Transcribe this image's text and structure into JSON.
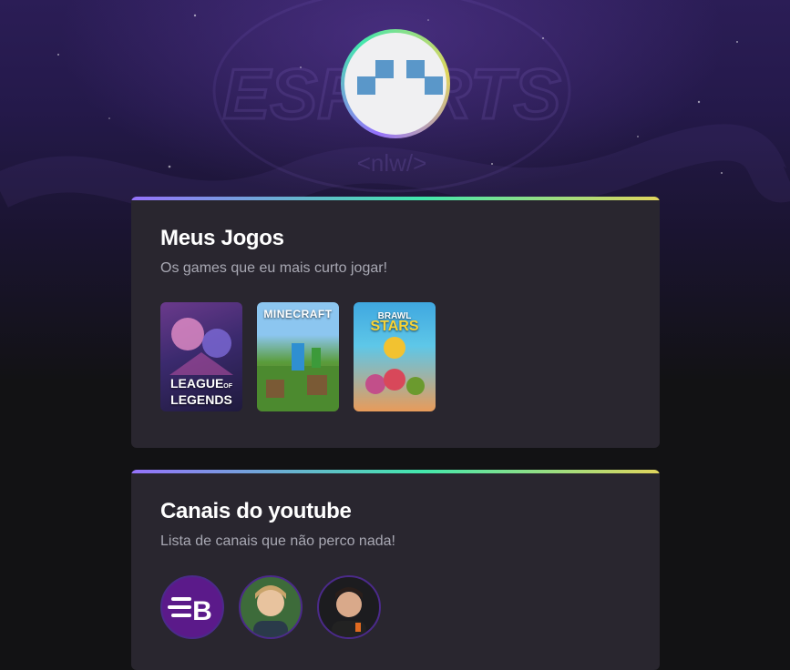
{
  "background": {
    "logo_text": "ESPORTS",
    "logo_subtext": "<nlw/>"
  },
  "profile": {
    "avatar": "github-identicon-avatar"
  },
  "games_section": {
    "title": "Meus Jogos",
    "subtitle": "Os games que eu mais curto jogar!",
    "games": [
      {
        "name": "League of Legends",
        "line1": "LEAGUE",
        "line1b": "OF",
        "line2": "LEGENDS"
      },
      {
        "name": "Minecraft",
        "line1": "MINECRAFT"
      },
      {
        "name": "Brawl Stars",
        "line1": "BRAWL",
        "line2": "STARS"
      }
    ]
  },
  "youtube_section": {
    "title": "Canais do youtube",
    "subtitle": "Lista de canais que não perco nada!",
    "channels": [
      {
        "avatar": "rocketseat-logo",
        "letter": "B"
      },
      {
        "avatar": "channel-avatar-blond-man"
      },
      {
        "avatar": "channel-avatar-dark-hair-man"
      }
    ]
  },
  "colors": {
    "card_bg": "#29262f",
    "gradient_start": "#9572fc",
    "gradient_mid": "#43e7ad",
    "gradient_end": "#e1d55d",
    "identicon": "#5a97c9"
  }
}
